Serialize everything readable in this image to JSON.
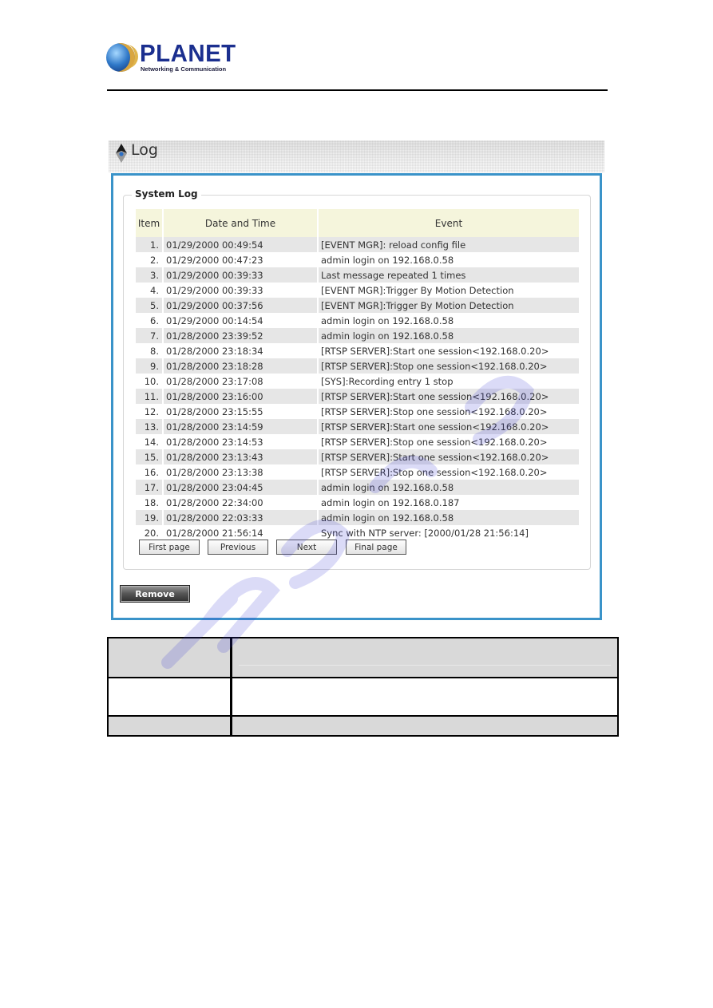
{
  "brand": {
    "name": "PLANET",
    "tagline": "Networking & Communication"
  },
  "panel": {
    "title": "Log",
    "section_title": "System Log",
    "accent_color": "#3a93c9",
    "columns": [
      "Item",
      "Date and Time",
      "Event"
    ],
    "rows": [
      {
        "item": "1.",
        "datetime": "01/29/2000 00:49:54",
        "event": "[EVENT MGR]: reload config file"
      },
      {
        "item": "2.",
        "datetime": "01/29/2000 00:47:23",
        "event": "admin login on 192.168.0.58"
      },
      {
        "item": "3.",
        "datetime": "01/29/2000 00:39:33",
        "event": "Last message repeated 1 times"
      },
      {
        "item": "4.",
        "datetime": "01/29/2000 00:39:33",
        "event": "[EVENT MGR]:Trigger By Motion Detection"
      },
      {
        "item": "5.",
        "datetime": "01/29/2000 00:37:56",
        "event": "[EVENT MGR]:Trigger By Motion Detection"
      },
      {
        "item": "6.",
        "datetime": "01/29/2000 00:14:54",
        "event": "admin login on 192.168.0.58"
      },
      {
        "item": "7.",
        "datetime": "01/28/2000 23:39:52",
        "event": "admin login on 192.168.0.58"
      },
      {
        "item": "8.",
        "datetime": "01/28/2000 23:18:34",
        "event": "[RTSP SERVER]:Start one session<192.168.0.20>"
      },
      {
        "item": "9.",
        "datetime": "01/28/2000 23:18:28",
        "event": "[RTSP SERVER]:Stop one session<192.168.0.20>"
      },
      {
        "item": "10.",
        "datetime": "01/28/2000 23:17:08",
        "event": "[SYS]:Recording entry 1 stop"
      },
      {
        "item": "11.",
        "datetime": "01/28/2000 23:16:00",
        "event": "[RTSP SERVER]:Start one session<192.168.0.20>"
      },
      {
        "item": "12.",
        "datetime": "01/28/2000 23:15:55",
        "event": "[RTSP SERVER]:Stop one session<192.168.0.20>"
      },
      {
        "item": "13.",
        "datetime": "01/28/2000 23:14:59",
        "event": "[RTSP SERVER]:Start one session<192.168.0.20>"
      },
      {
        "item": "14.",
        "datetime": "01/28/2000 23:14:53",
        "event": "[RTSP SERVER]:Stop one session<192.168.0.20>"
      },
      {
        "item": "15.",
        "datetime": "01/28/2000 23:13:43",
        "event": "[RTSP SERVER]:Start one session<192.168.0.20>"
      },
      {
        "item": "16.",
        "datetime": "01/28/2000 23:13:38",
        "event": "[RTSP SERVER]:Stop one session<192.168.0.20>"
      },
      {
        "item": "17.",
        "datetime": "01/28/2000 23:04:45",
        "event": "admin login on 192.168.0.58"
      },
      {
        "item": "18.",
        "datetime": "01/28/2000 22:34:00",
        "event": "admin login on 192.168.0.187"
      },
      {
        "item": "19.",
        "datetime": "01/28/2000 22:03:33",
        "event": "admin login on 192.168.0.58"
      },
      {
        "item": "20.",
        "datetime": "01/28/2000 21:56:14",
        "event": "Sync with NTP server: [2000/01/28 21:56:14]"
      }
    ],
    "pager": {
      "first": "First page",
      "previous": "Previous",
      "next": "Next",
      "final": "Final page"
    },
    "remove_label": "Remove"
  }
}
